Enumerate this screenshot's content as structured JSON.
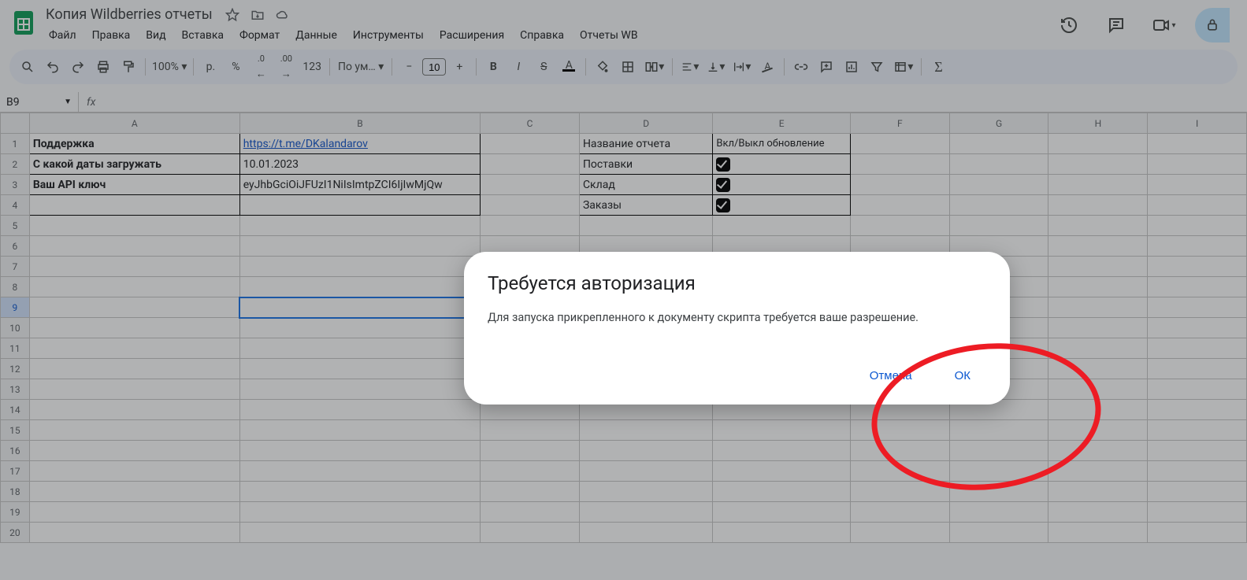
{
  "doc": {
    "title": "Копия Wildberries отчеты"
  },
  "menu": [
    "Файл",
    "Правка",
    "Вид",
    "Вставка",
    "Формат",
    "Данные",
    "Инструменты",
    "Расширения",
    "Справка",
    "Отчеты WB"
  ],
  "toolbar": {
    "zoom": "100%",
    "currency": "р.",
    "percent": "%",
    "decdec": ".0",
    "incdec": ".00",
    "numfmt": "123",
    "font": "По ум…",
    "fontsize": "10"
  },
  "namebox": "B9",
  "columns": [
    "A",
    "B",
    "C",
    "D",
    "E",
    "F",
    "G",
    "H",
    "I"
  ],
  "rows": 20,
  "cells": {
    "A1": "Поддержка",
    "B1": "https://t.me/DKalandarov",
    "A2": "С какой даты загружать",
    "B2": "10.01.2023",
    "A3": "Ваш API ключ",
    "B3": "eyJhbGciOiJFUzI1NiIsImtpZCI6IjIwMjQw",
    "D1": "Название  отчета",
    "E1": "Вкл/Выкл обновление",
    "D2": "Поставки",
    "D3": "Склад",
    "D4": "Заказы"
  },
  "dialog": {
    "title": "Требуется авторизация",
    "message": "Для запуска прикрепленного к документу скрипта требуется ваше разрешение.",
    "cancel": "Отмена",
    "ok": "ОК"
  }
}
